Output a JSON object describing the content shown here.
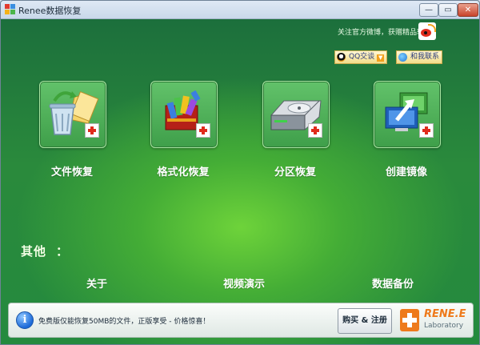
{
  "window": {
    "title": "Renee数据恢复",
    "min_label": "—",
    "max_label": "▭",
    "close_label": "✕"
  },
  "header": {
    "follow_text": "关注官方微博，获赠精品软件",
    "weibo_icon": "weibo-icon",
    "qq_button": "QQ交谈",
    "contact_button": "和我联系"
  },
  "tiles": [
    {
      "label": "文件恢复",
      "icon": "recycle-bin-icon"
    },
    {
      "label": "格式化恢复",
      "icon": "stacked-blocks-icon"
    },
    {
      "label": "分区恢复",
      "icon": "hard-drive-icon"
    },
    {
      "label": "创建镜像",
      "icon": "monitor-arrow-icon"
    }
  ],
  "others": {
    "heading": "其他",
    "colon": "：",
    "links": [
      "关于",
      "视频演示",
      "数据备份"
    ]
  },
  "statusbar": {
    "notice": "免费版仅能恢复50MB的文件，正版享受 - 价格惊喜！",
    "buy_button": "购买 & 注册",
    "logo_brand": "RENE.E",
    "logo_sub": "Laboratory"
  },
  "colors": {
    "accent_green": "#3f9f4a",
    "brand_orange": "#ee7a1c",
    "plus_red": "#e02b1c"
  }
}
